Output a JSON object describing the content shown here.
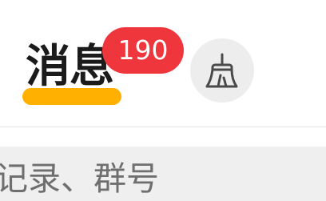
{
  "header": {
    "title": "消息",
    "unread_badge": "190",
    "clean_button": {
      "icon": "broom-icon"
    }
  },
  "search": {
    "placeholder_visible": "记录、群号"
  },
  "colors": {
    "title_text": "#1b1b1b",
    "title_underline": "#ffb000",
    "badge_background": "#f0363d",
    "badge_text": "#ffffff",
    "clean_button_background": "#ededed",
    "icon_stroke": "#4a4a4a",
    "search_background": "#efefef",
    "search_text": "#6f6f6f",
    "divider": "#e6e6e6"
  }
}
